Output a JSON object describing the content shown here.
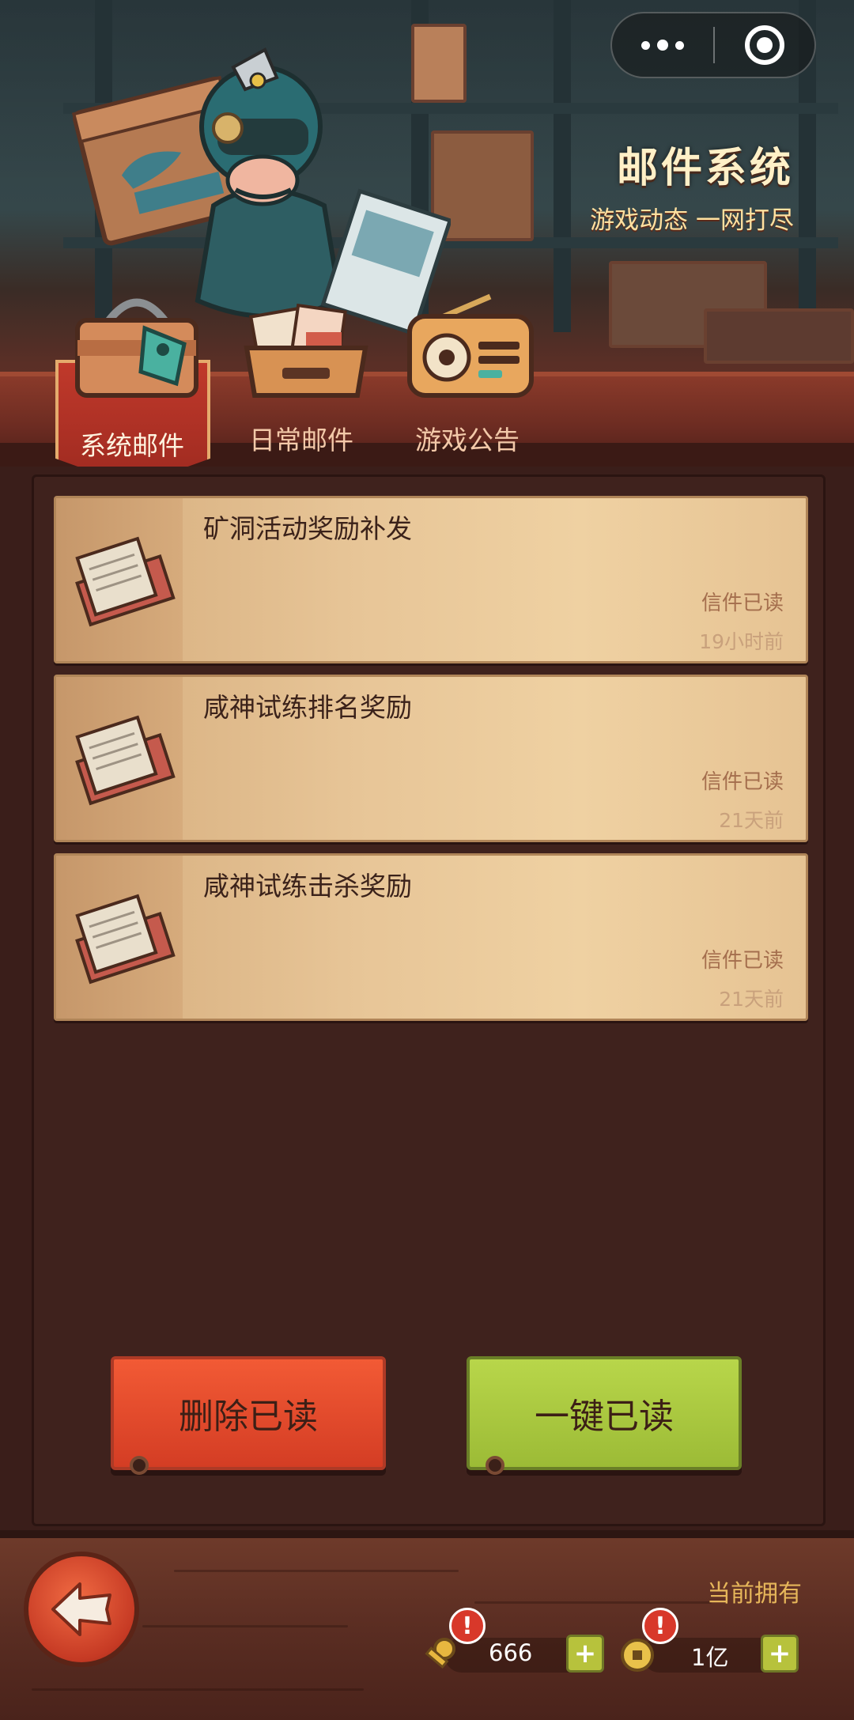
{
  "header": {
    "title": "邮件系统",
    "subtitle": "游戏动态 一网打尽"
  },
  "capsule": {
    "more_icon": "more-dots-icon",
    "close_icon": "target-icon"
  },
  "tabs": [
    {
      "label": "系统邮件",
      "active": true,
      "icon": "locked-chest-icon"
    },
    {
      "label": "日常邮件",
      "active": false,
      "icon": "letter-tray-icon"
    },
    {
      "label": "游戏公告",
      "active": false,
      "icon": "radio-icon"
    }
  ],
  "mails": [
    {
      "title": "矿洞活动奖励补发",
      "status": "信件已读",
      "time": "19小时前"
    },
    {
      "title": "咸神试练排名奖励",
      "status": "信件已读",
      "time": "21天前"
    },
    {
      "title": "咸神试练击杀奖励",
      "status": "信件已读",
      "time": "21天前"
    }
  ],
  "actions": {
    "delete_read": "删除已读",
    "mark_all_read": "一键已读"
  },
  "footer": {
    "owned_label": "当前拥有",
    "resources": [
      {
        "icon": "golden-key-icon",
        "value": "666",
        "alert": "!"
      },
      {
        "icon": "coin-icon",
        "value": "1亿",
        "alert": "!"
      }
    ],
    "plus_label": "+"
  },
  "colors": {
    "accent_red": "#d43d24",
    "accent_green": "#9cbb36",
    "mail_card": "#e7c597",
    "title_cream": "#fff0c7"
  }
}
